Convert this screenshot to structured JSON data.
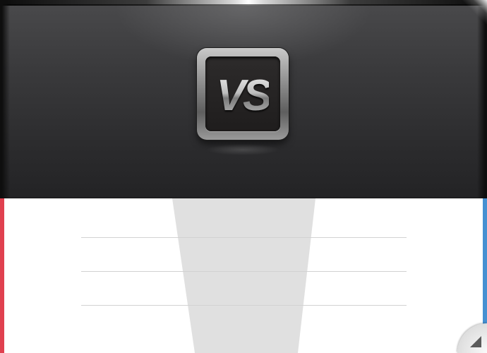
{
  "header": {
    "badge_text": "VS",
    "badge_icon": "vs-badge-icon"
  },
  "body": {
    "divider_rows": 3,
    "left_team_color": "#e0404f",
    "right_team_color": "#4690d2",
    "beam_color": "#e0e0e0"
  },
  "controls": {
    "resize_icon": "resize-corner-icon"
  }
}
